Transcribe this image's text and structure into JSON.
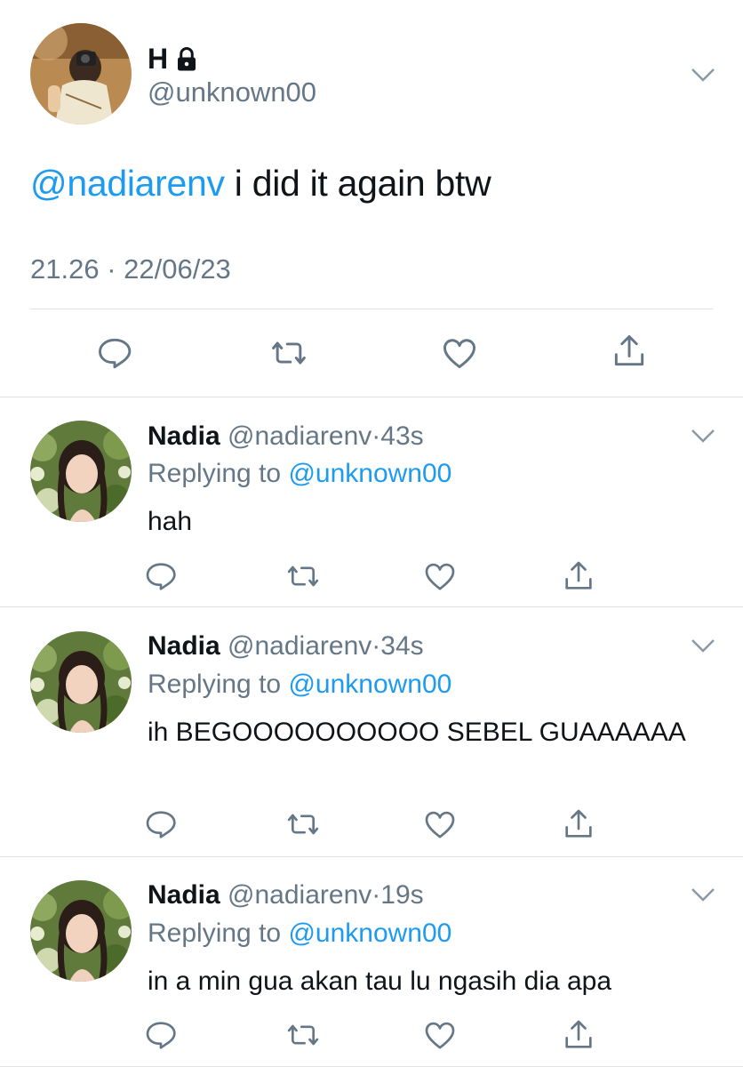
{
  "main_tweet": {
    "display_name": "H",
    "handle": "@unknown00",
    "text_mention": "@nadiarenv",
    "text_body": " i did it again btw",
    "timestamp": "21.26 · 22/06/23",
    "avatar_icon": "user-avatar-photo",
    "lock_icon": "lock-icon"
  },
  "replies": [
    {
      "name": "Nadia",
      "handle": "@nadiarenv",
      "sep": "·",
      "age": "43s",
      "replying_label": "Replying to ",
      "replying_to": "@unknown00",
      "text": "hah"
    },
    {
      "name": "Nadia",
      "handle": "@nadiarenv",
      "sep": "·",
      "age": "34s",
      "replying_label": "Replying to ",
      "replying_to": "@unknown00",
      "text": "ih BEGOOOOOOOOOO SEBEL GUAAAAAA"
    },
    {
      "name": "Nadia",
      "handle": "@nadiarenv",
      "sep": "·",
      "age": "19s",
      "replying_label": "Replying to ",
      "replying_to": "@unknown00",
      "text": "in a min gua akan tau lu ngasih dia apa"
    }
  ],
  "icons": {
    "reply": "reply-icon",
    "retweet": "retweet-icon",
    "like": "heart-icon",
    "share": "share-icon",
    "more": "chevron-down-icon"
  },
  "colors": {
    "accent": "#1d9bf0",
    "secondary_text": "#657786",
    "icon": "#657786",
    "divider": "#dde2e6"
  }
}
